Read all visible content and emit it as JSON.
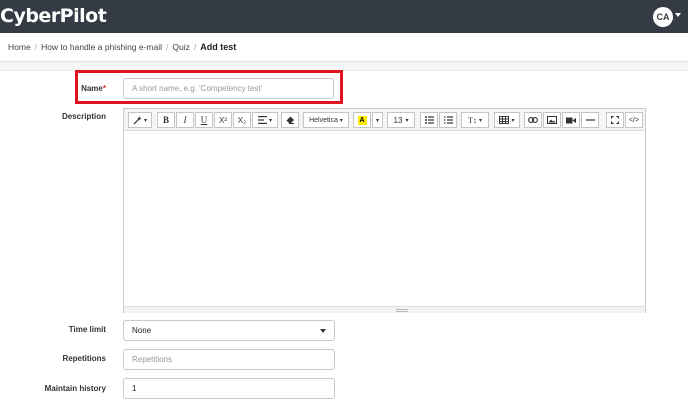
{
  "header": {
    "logo": "CyberPilot",
    "avatar_initials": "CA",
    "background": "#343b45"
  },
  "breadcrumb": {
    "items": [
      "Home",
      "How to handle a phishing e-mail",
      "Quiz"
    ],
    "current": "Add test"
  },
  "form": {
    "name": {
      "label": "Name",
      "required_mark": "*",
      "placeholder": "A short name, e.g. 'Competency test'"
    },
    "description": {
      "label": "Description",
      "toolbar": {
        "magic_icon": "magic-wand-icon",
        "bold": "B",
        "italic": "I",
        "underline": "U",
        "superscript": "X²",
        "subscript": "X₂",
        "font_family": "Helvetica",
        "highlight": "A",
        "font_size": "13",
        "line_height": "T↕",
        "code_view": "</>"
      }
    },
    "time_limit": {
      "label": "Time limit",
      "selected": "None"
    },
    "repetitions": {
      "label": "Repetitions",
      "placeholder": "Repetitions"
    },
    "maintain_history": {
      "label": "Maintain history",
      "value": "1"
    }
  },
  "colors": {
    "highlight_border": "#e0141e",
    "required": "#c33"
  }
}
